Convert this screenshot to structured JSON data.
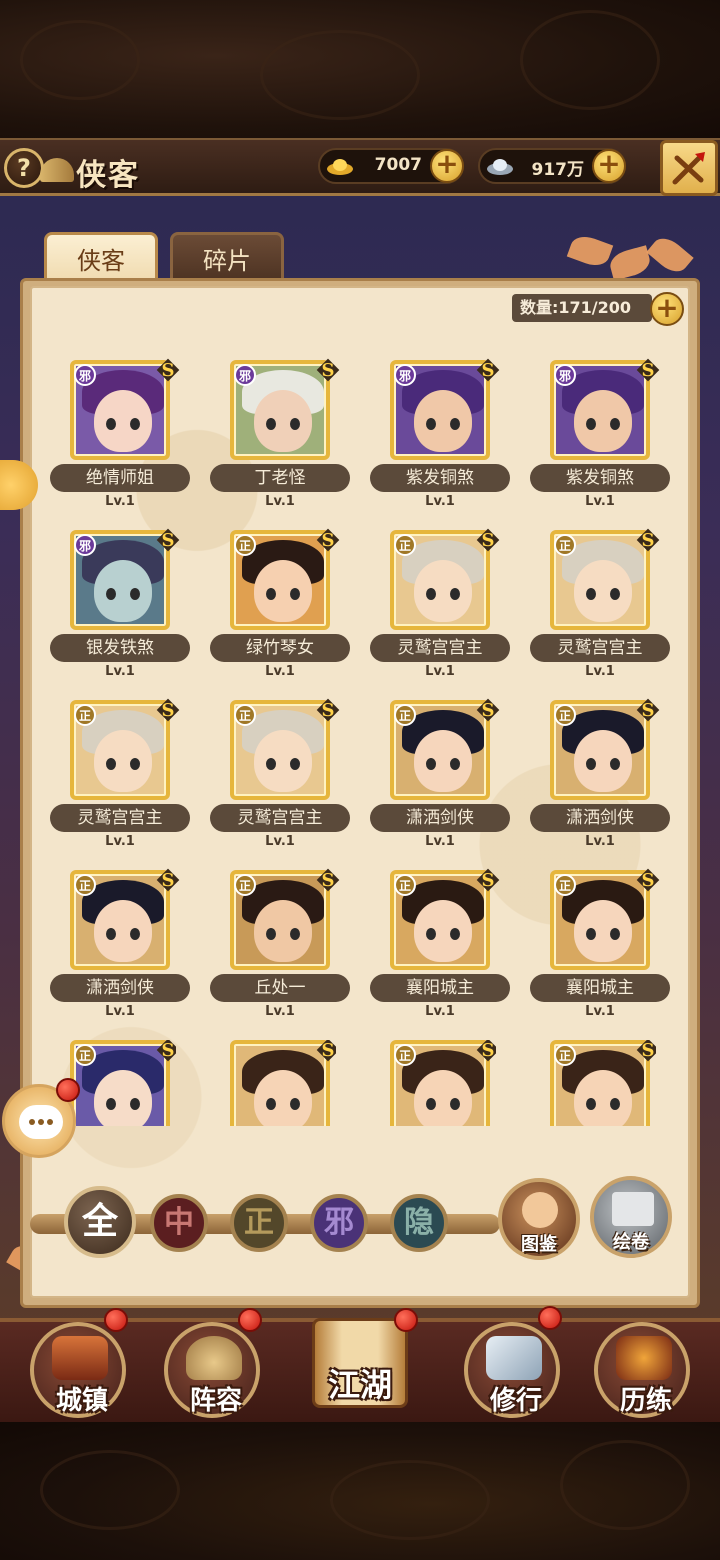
{
  "header": {
    "title": "侠客",
    "gold_value": "7007",
    "silver_value": "917万",
    "help_icon": "?"
  },
  "tabs": [
    {
      "label": "侠客",
      "active": true
    },
    {
      "label": "碎片",
      "active": false
    }
  ],
  "roster": {
    "count_label": "数量:171/200"
  },
  "heroes": [
    {
      "name": "绝情师姐",
      "level": "Lv.1",
      "faction": "邪",
      "grade": "S"
    },
    {
      "name": "丁老怪",
      "level": "Lv.1",
      "faction": "邪",
      "grade": "S"
    },
    {
      "name": "紫发铜煞",
      "level": "Lv.1",
      "faction": "邪",
      "grade": "S"
    },
    {
      "name": "紫发铜煞",
      "level": "Lv.1",
      "faction": "邪",
      "grade": "S"
    },
    {
      "name": "银发铁煞",
      "level": "Lv.1",
      "faction": "邪",
      "grade": "S"
    },
    {
      "name": "绿竹琴女",
      "level": "Lv.1",
      "faction": "正",
      "grade": "S"
    },
    {
      "name": "灵鹫宫宫主",
      "level": "Lv.1",
      "faction": "正",
      "grade": "S"
    },
    {
      "name": "灵鹫宫宫主",
      "level": "Lv.1",
      "faction": "正",
      "grade": "S"
    },
    {
      "name": "灵鹫宫宫主",
      "level": "Lv.1",
      "faction": "正",
      "grade": "S"
    },
    {
      "name": "灵鹫宫宫主",
      "level": "Lv.1",
      "faction": "正",
      "grade": "S"
    },
    {
      "name": "潇洒剑侠",
      "level": "Lv.1",
      "faction": "正",
      "grade": "S"
    },
    {
      "name": "潇洒剑侠",
      "level": "Lv.1",
      "faction": "正",
      "grade": "S"
    },
    {
      "name": "潇洒剑侠",
      "level": "Lv.1",
      "faction": "正",
      "grade": "S"
    },
    {
      "name": "丘处一",
      "level": "Lv.1",
      "faction": "正",
      "grade": "S"
    },
    {
      "name": "襄阳城主",
      "level": "Lv.1",
      "faction": "正",
      "grade": "S"
    },
    {
      "name": "襄阳城主",
      "level": "Lv.1",
      "faction": "正",
      "grade": "S"
    },
    {
      "name": "",
      "level": "",
      "faction": "正",
      "grade": "S"
    },
    {
      "name": "",
      "level": "",
      "faction": "",
      "grade": "S"
    },
    {
      "name": "",
      "level": "",
      "faction": "正",
      "grade": "S"
    },
    {
      "name": "",
      "level": "",
      "faction": "正",
      "grade": "S"
    }
  ],
  "filters": {
    "all": "全",
    "zhong": "中",
    "zheng": "正",
    "xie": "邪",
    "yin": "隐"
  },
  "side_buttons": {
    "codex": "图鉴",
    "scroll": "绘卷"
  },
  "bottom_nav": [
    {
      "label": "城镇",
      "badge": true
    },
    {
      "label": "阵容",
      "badge": true
    },
    {
      "label": "江湖",
      "badge": true
    },
    {
      "label": "修行",
      "badge": true
    },
    {
      "label": "历练",
      "badge": false
    }
  ],
  "colors": {
    "gold_border": "#e6b63c",
    "name_plate": "#5b4a3a",
    "panel_bg": "#f3e5cb",
    "badge_red": "#c4140c"
  },
  "icons": {
    "gold": "gold-ingot-icon",
    "silver": "silver-ingot-icon",
    "close": "close-swords-icon",
    "chat": "chat-bubble-icon"
  }
}
